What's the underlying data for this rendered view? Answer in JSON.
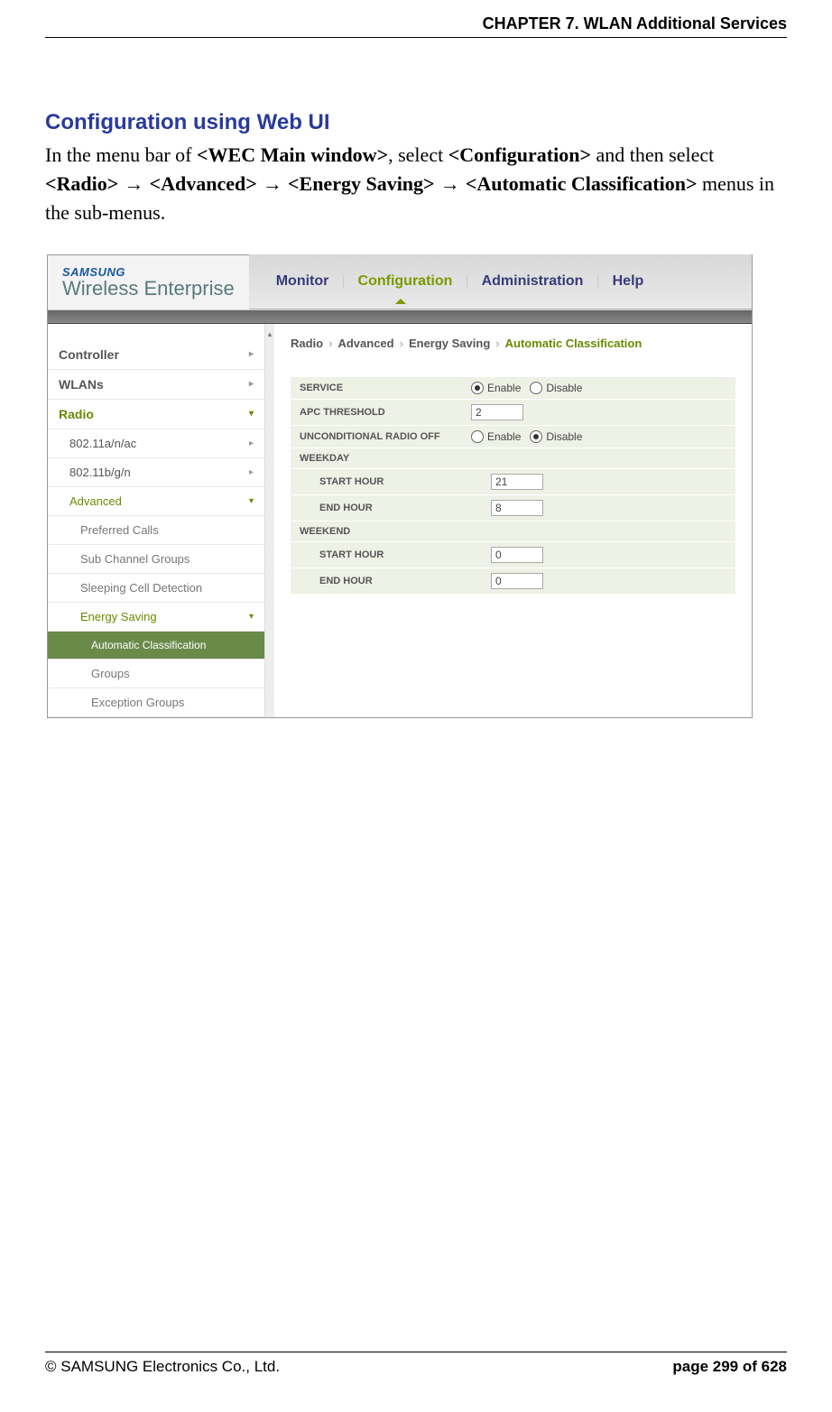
{
  "page": {
    "chapter_header": "CHAPTER 7. WLAN Additional Services",
    "section_title": "Configuration using Web UI",
    "body_intro_1": "In the menu bar of ",
    "body_bold_1": "<WEC Main window>",
    "body_intro_2": ", select ",
    "body_bold_2": "<Configuration>",
    "body_intro_3": " and then select ",
    "body_bold_3": "<Radio>",
    "arrow": " → ",
    "body_bold_4": "<Advanced>",
    "body_bold_5": "<Energy Saving>",
    "body_bold_6": "<Automatic Classification>",
    "body_intro_4": " menus in the sub-menus."
  },
  "screenshot": {
    "logo_line1": "SAMSUNG",
    "logo_line2": "Wireless Enterprise",
    "topnav": {
      "monitor": "Monitor",
      "configuration": "Configuration",
      "administration": "Administration",
      "help": "Help"
    },
    "sidebar": {
      "controller": "Controller",
      "wlans": "WLANs",
      "radio": "Radio",
      "r_802_11a": "802.11a/n/ac",
      "r_802_11b": "802.11b/g/n",
      "advanced": "Advanced",
      "preferred_calls": "Preferred Calls",
      "sub_channel": "Sub Channel Groups",
      "sleeping_cell": "Sleeping Cell Detection",
      "energy_saving": "Energy Saving",
      "automatic_classification": "Automatic Classification",
      "groups": "Groups",
      "exception_groups": "Exception Groups"
    },
    "breadcrumb": {
      "radio": "Radio",
      "advanced": "Advanced",
      "energy_saving": "Energy Saving",
      "automatic_classification": "Automatic Classification"
    },
    "form": {
      "service_label": "SERVICE",
      "enable": "Enable",
      "disable": "Disable",
      "service_selected": "enable",
      "apc_threshold_label": "APC THRESHOLD",
      "apc_threshold_value": "2",
      "uro_label": "UNCONDITIONAL RADIO OFF",
      "uro_selected": "disable",
      "weekday_label": "WEEKDAY",
      "start_hour_label": "START HOUR",
      "end_hour_label": "END HOUR",
      "weekday_start": "21",
      "weekday_end": "8",
      "weekend_label": "WEEKEND",
      "weekend_start": "0",
      "weekend_end": "0"
    }
  },
  "footer": {
    "copyright": "© SAMSUNG Electronics Co., Ltd.",
    "page_label": "page 299 of 628"
  }
}
